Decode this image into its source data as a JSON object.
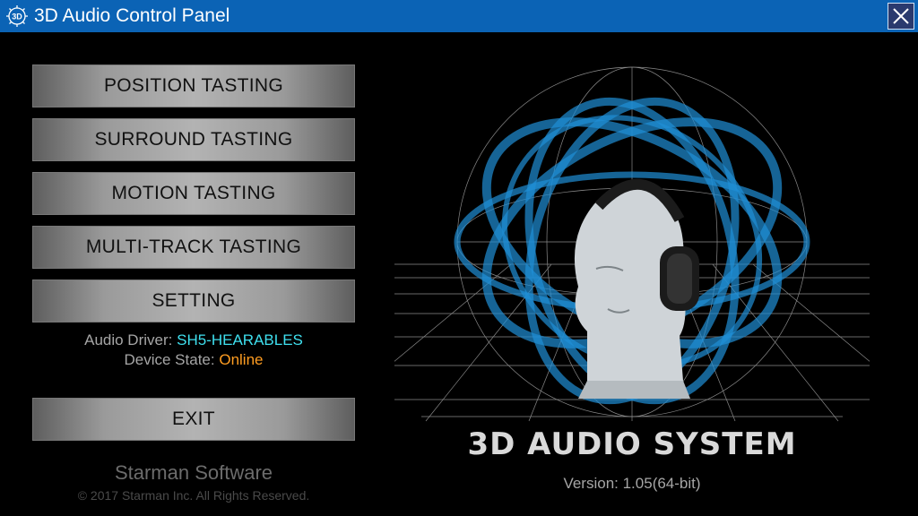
{
  "window": {
    "title": "3D Audio Control Panel",
    "icon_label": "3D",
    "close_icon": "close-icon"
  },
  "menu": {
    "position": "POSITION TASTING",
    "surround": "SURROUND TASTING",
    "motion": "MOTION TASTING",
    "multitrack": "MULTI-TRACK TASTING",
    "setting": "SETTING",
    "exit": "EXIT"
  },
  "status": {
    "driver_label": "Audio Driver:",
    "driver_value": "SH5-HEARABLES",
    "state_label": "Device State:",
    "state_value": "Online",
    "driver_color": "#3fe0ef",
    "state_color": "#ff9d21"
  },
  "brand": {
    "name": "Starman Software",
    "copyright": "© 2017 Starman Inc. All Rights Reserved."
  },
  "hero": {
    "title": "3D AUDIO SYSTEM",
    "version": "Version: 1.05(64-bit)"
  },
  "colors": {
    "titlebar": "#0b63b5",
    "accent_rings": "#1f8fd6"
  }
}
